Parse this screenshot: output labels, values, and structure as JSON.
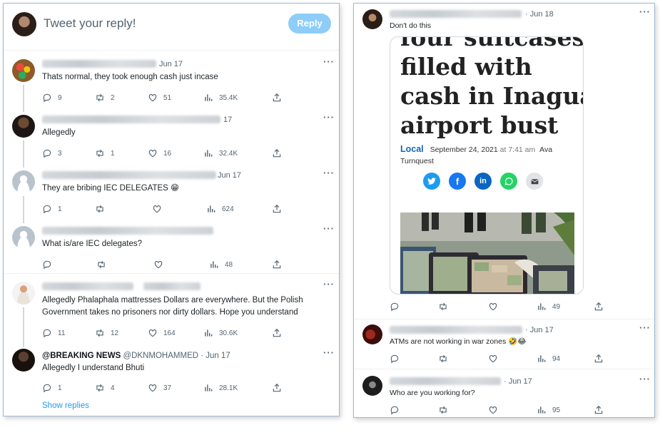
{
  "compose": {
    "placeholder": "Tweet your reply!",
    "reply_label": "Reply"
  },
  "left_tweets": [
    {
      "date": "Jun 17",
      "text": "Thats normal, they took enough cash just incase",
      "replies": "9",
      "retweets": "2",
      "likes": "51",
      "views": "35.4K"
    },
    {
      "date": "17",
      "text": "Allegedly",
      "replies": "3",
      "retweets": "1",
      "likes": "16",
      "views": "32.4K"
    },
    {
      "date": "Jun 17",
      "text": "They are bribing IEC DELEGATES 😁",
      "replies": "1",
      "retweets": "",
      "likes": "",
      "views": "624"
    },
    {
      "date": "",
      "text": "What is/are IEC delegates?",
      "replies": "",
      "retweets": "",
      "likes": "",
      "views": "48"
    },
    {
      "date": "",
      "text_line1": "Allegedly Phalaphala mattresses Dollars are everywhere. But the Polish",
      "text_line2": "Government takes no prisoners nor dirty dollars. Hope you understand",
      "replies": "11",
      "retweets": "12",
      "likes": "164",
      "views": "30.6K"
    },
    {
      "display_name": "@BREAKING NEWS",
      "handle": "@DKNMOHAMMED",
      "date": "· Jun 17",
      "text": "Allegedly I understand Bhuti",
      "replies": "1",
      "retweets": "4",
      "likes": "37",
      "views": "28.1K"
    }
  ],
  "show_replies": "Show replies",
  "right_main": {
    "date": "· Jun 18",
    "text": "Don't do this",
    "article": {
      "headline_lines": [
        "four suitcases",
        "filled with",
        "cash in Inagua",
        "airport bust"
      ],
      "category": "Local",
      "date": "September 24, 2021",
      "time": "at 7:41 am",
      "author_part1": "Ava",
      "author_part2": "Turnquest"
    },
    "replies": "",
    "retweets": "",
    "likes": "",
    "views": "49"
  },
  "right_replies": [
    {
      "date": "· Jun 17",
      "text": "ATMs are not working in war zones 🤣😂",
      "views": "94"
    },
    {
      "date": "· Jun 17",
      "text": "Who are you working for?",
      "views": "95"
    }
  ],
  "colors": {
    "accent": "#1d9bf0",
    "reply_button": "#8ecdf8",
    "twitter": "#1d9bf0",
    "facebook": "#1877f2",
    "linkedin": "#0a66c2",
    "whatsapp": "#25d366",
    "email": "#e1e4e6"
  },
  "icons": [
    "reply-icon",
    "retweet-icon",
    "like-icon",
    "views-icon",
    "share-icon",
    "more-icon"
  ]
}
